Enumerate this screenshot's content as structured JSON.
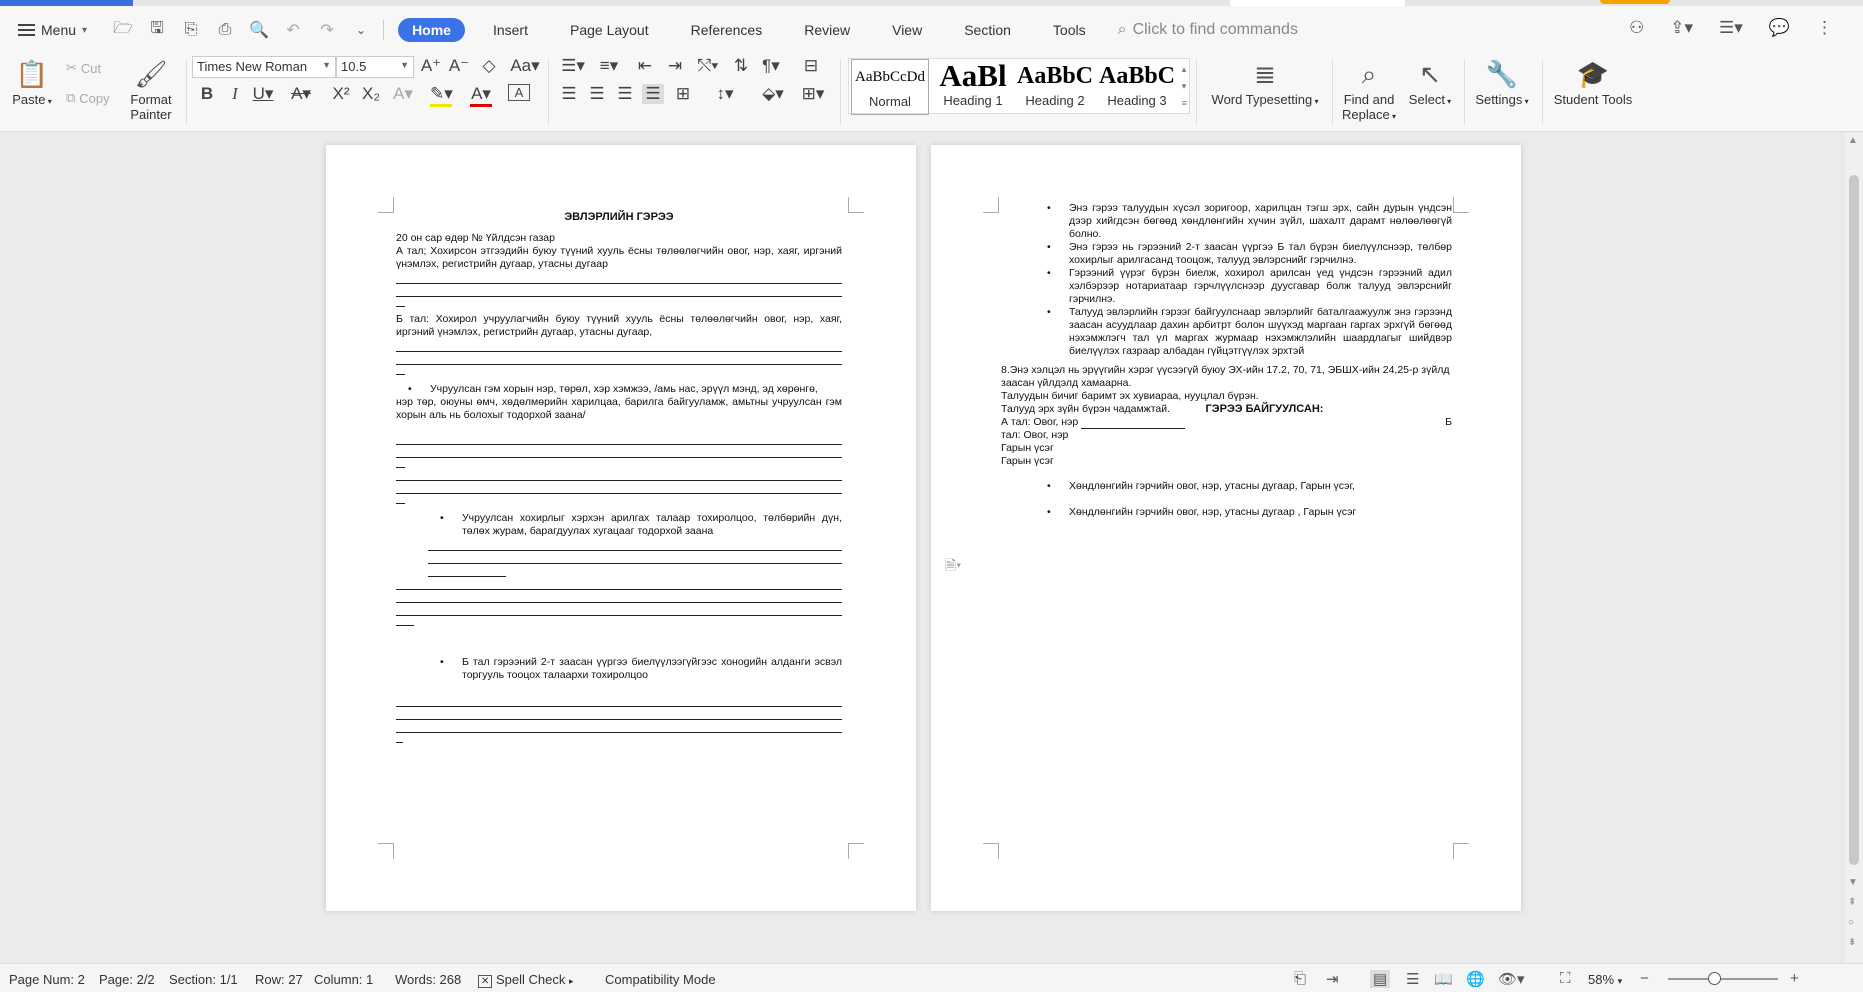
{
  "menu": {
    "label": "Menu",
    "tabs": [
      "Home",
      "Insert",
      "Page Layout",
      "References",
      "Review",
      "View",
      "Section",
      "Tools"
    ],
    "active_tab": "Home",
    "search_placeholder": "Click to find commands"
  },
  "ribbon": {
    "paste": "Paste",
    "cut": "Cut",
    "copy": "Copy",
    "format_painter_1": "Format",
    "format_painter_2": "Painter",
    "font_name": "Times New Roman",
    "font_size": "10.5",
    "styles": [
      {
        "preview": "AaBbCcDd",
        "label": "Normal"
      },
      {
        "preview": "AaBl",
        "label": "Heading 1"
      },
      {
        "preview": "AaBbC",
        "label": "Heading 2"
      },
      {
        "preview": "AaBbC",
        "label": "Heading 3"
      }
    ],
    "word_typesetting": "Word Typesetting",
    "find_replace_1": "Find and",
    "find_replace_2": "Replace",
    "select": "Select",
    "settings": "Settings",
    "student_tools": "Student Tools"
  },
  "doc": {
    "p1_title": "ЭВЛЭРЛИЙН ГЭРЭЭ",
    "p1_date": "20   он   сар өдөр      №   Үйлдсэн газар",
    "p1_a": "А тал; Хохирсон этгээдийн буюу түүний хууль ёсны төлөөлөгчийн овог, нэр, хаяг, иргэний үнэмлэх, регистрийн дугаар, утасны дугаар",
    "p1_b": "Б тал: Хохирол учруулагчийн буюу түүний хууль ёсны төлөөлөгчийн овог, нэр, хаяг, иргэний үнэмлэх, регистрийн дугаар, утасны дугаар,",
    "p1_bullet1": "Учруулсан гэм хорын нэр, төрөл, хэр хэмжээ, /амь нас, эрүүл мэнд, эд хөрөнгө,",
    "p1_bullet1_cont": "нэр төр, оюуны өмч, хөдөлмөрийн харилцаа, барилга байгууламж, амьтны учруулсан гэм хорын аль нь болохыг тодорхой заана/",
    "p1_bullet2": "Учруулсан хохирлыг хэрхэн арилгах талаар тохиролцоо, төлбөрийн дүн, төлөх журам, барагдуулах хугацааг тодорхой заана",
    "p1_bullet3": "Б тал гэрээний 2-т заасан үүргээ биелүүлээгүйгээс хонogийн алданги эсвэл торгууль тооцох талаархи тохиролцоо",
    "p2_bullet1": "Энэ гэрээ талуудын хүсэл зоригоор, харилцан тэгш эрх, сайн дурын үндсэн дээр хийгдсэн бөгөөд хөндлөнгийн хүчин зүйл, шахалт дарамт нөлөөлөөгүй болно.",
    "p2_bullet2": "Энэ гэрээ нь гэрээний 2-т заасан үүргээ Б тал бүрэн биелүүлснээр, төлбөр хохирлыг арилгасанд тооцож, талууд эвлэрснийг гэрчилнэ.",
    "p2_bullet3": "Гэрээний үүрэг бүрэн биелж, хохирол арилсан үед үндсэн гэрээний адил хэлбэрээр нотариатаар гэрчлүүлснээр дуусгавар болж талууд эвлэрснийг гэрчилнэ.",
    "p2_bullet4": "Талууд эвлэрлийн гэрээг байгуулснаар эвлэрлийг баталгаажуулж энэ гэрээнд заасан асуудлаар дахин арбитрт болон шүүхэд маргаан гаргах эрхгүй бөгөөд нэхэмжлэгч тал үл маргах журмаар нэхэмжлэлийн шаардлагыг шийдвэр биелүүлэх газраар албадан гүйцэтгүүлэх эрхтэй",
    "p2_8": "8.Энэ хэлцэл нь эрүүгийн хэрэг үүсээгүй буюу ЭХ-ийн 17.2, 70, 71, ЭБШХ-ийн 24,25-р зүйлд заасан үйлдэлд хамаарна.",
    "p2_copies": "Талуудын бичиг баримт эх хувиараа, нууцлал бүрэн.",
    "p2_consent": "Талууд эрх зүйн бүрэн чадамжтай.",
    "p2_signed": "ГЭРЭЭ БАЙГУУЛСАН:",
    "p2_a_sig": "А тал: Овог, нэр",
    "p2_b_letter": "Б",
    "p2_b_sig": "тал: Овог, нэр",
    "p2_sign1": "Гарын үсэг",
    "p2_sign2": "Гарын үсэг",
    "p2_witness1": "Хөндлөнгийн гэрчийн овог, нэр, утасны дугаар, Гарын үсэг,",
    "p2_witness2": "Хөндлөнгийн гэрчийн овог, нэр, утасны дугаар , Гарын үсэг"
  },
  "status": {
    "page_num": "Page Num: 2",
    "page": "Page: 2/2",
    "section": "Section: 1/1",
    "row": "Row: 27",
    "column": "Column: 1",
    "words": "Words: 268",
    "spell_check": "Spell Check",
    "compat": "Compatibility Mode",
    "zoom": "58%"
  }
}
